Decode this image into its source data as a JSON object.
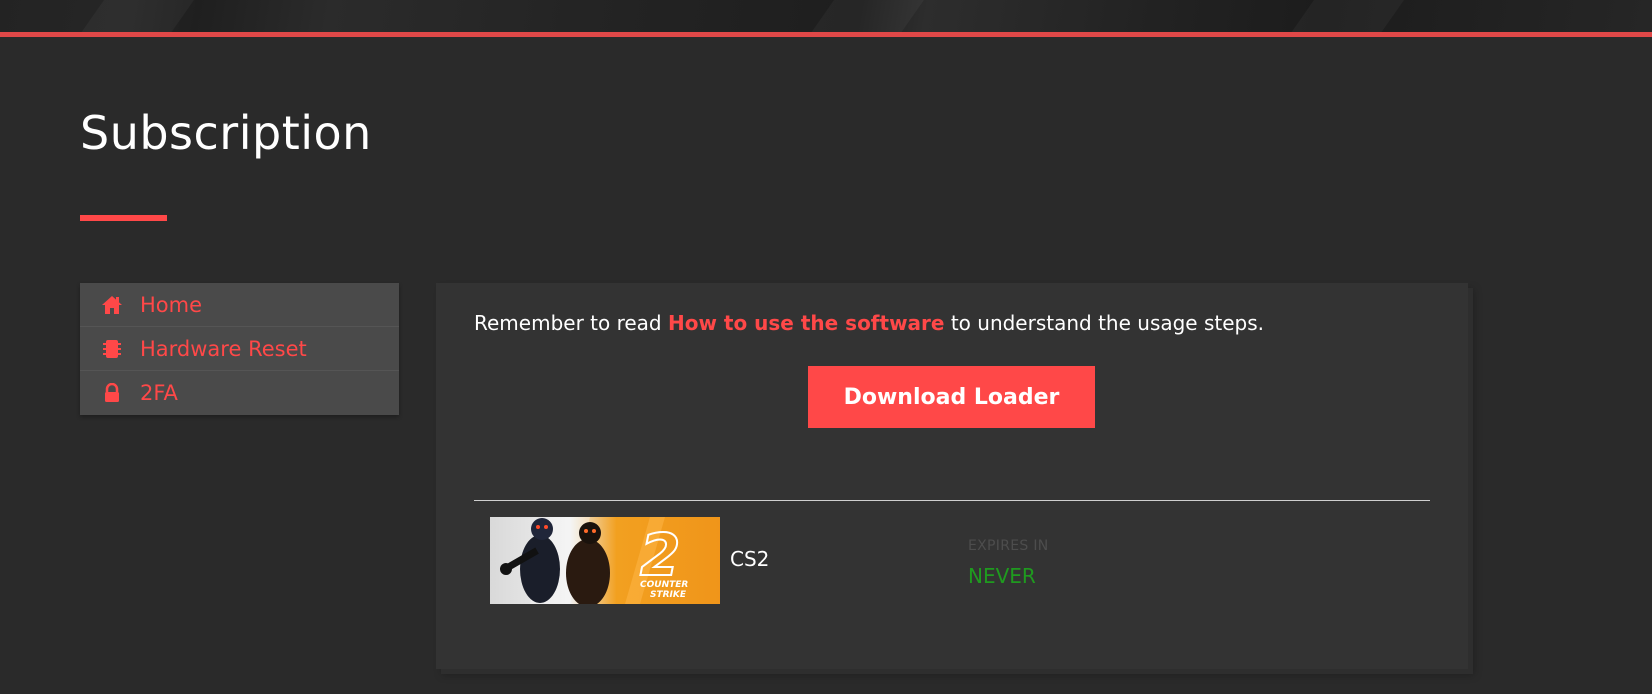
{
  "page": {
    "title": "Subscription"
  },
  "sidebar": {
    "items": [
      {
        "label": "Home",
        "icon": "home-icon"
      },
      {
        "label": "Hardware Reset",
        "icon": "chip-icon"
      },
      {
        "label": "2FA",
        "icon": "lock-icon"
      }
    ]
  },
  "main": {
    "notice_prefix": "Remember to read ",
    "notice_link": "How to use the software",
    "notice_suffix": " to understand the usage steps.",
    "download_label": "Download Loader",
    "subscription": {
      "game_name": "CS2",
      "thumbnail_text_number": "2",
      "thumbnail_text_line1": "COUNTER",
      "thumbnail_text_line2": "STRIKE",
      "expires_label": "EXPIRES IN",
      "expires_value": "NEVER"
    }
  },
  "colors": {
    "accent": "#ff4848",
    "background": "#2a2a2a",
    "card": "#333333",
    "sidebar": "#4a4a4a",
    "success": "#1f9a1f"
  }
}
